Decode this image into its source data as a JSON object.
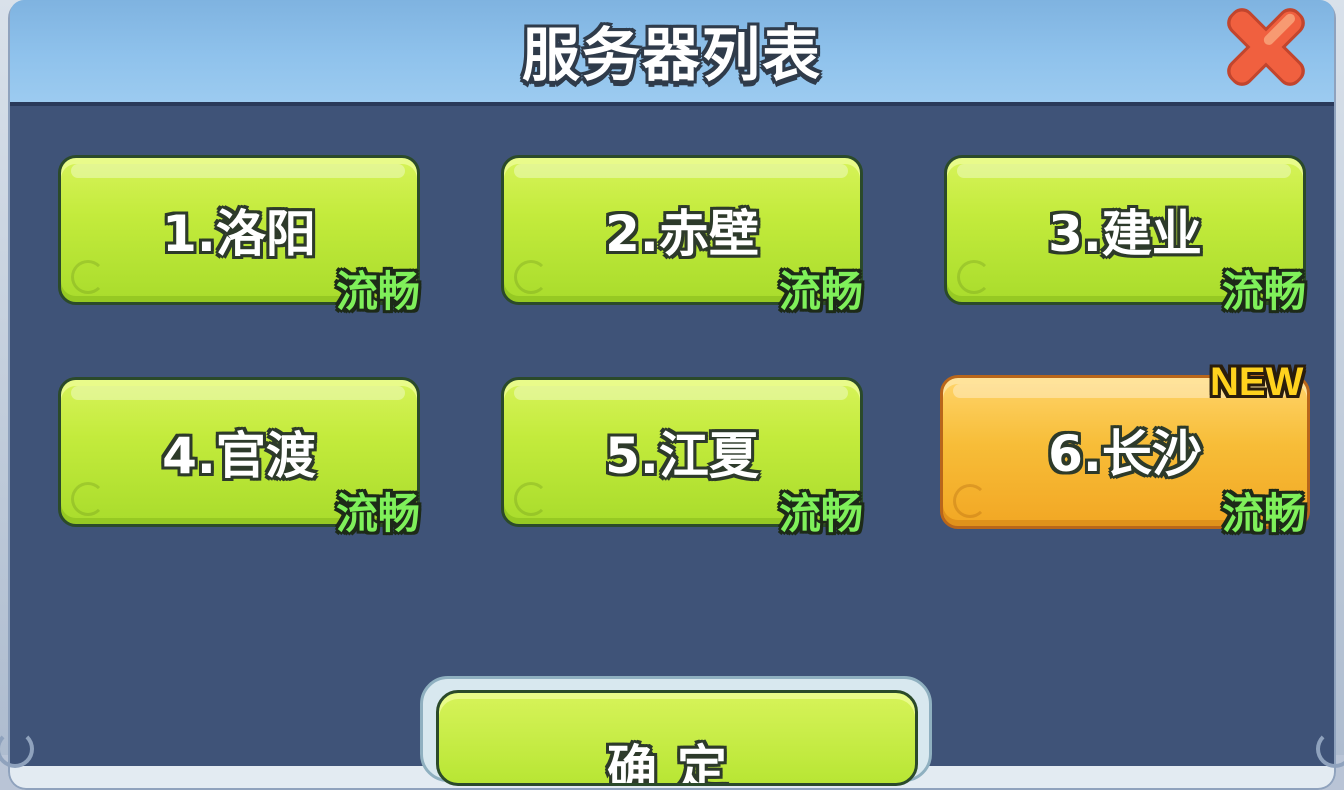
{
  "dialog": {
    "title": "服务器列表",
    "close_icon": "close-x-icon"
  },
  "servers": [
    {
      "name": "1.洛阳",
      "status": "流畅",
      "is_new": false
    },
    {
      "name": "2.赤壁",
      "status": "流畅",
      "is_new": false
    },
    {
      "name": "3.建业",
      "status": "流畅",
      "is_new": false
    },
    {
      "name": "4.官渡",
      "status": "流畅",
      "is_new": false
    },
    {
      "name": "5.江夏",
      "status": "流畅",
      "is_new": false
    },
    {
      "name": "6.长沙",
      "status": "流畅",
      "is_new": true
    }
  ],
  "badge": {
    "new_label": "NEW"
  },
  "confirm": {
    "label": "确定"
  },
  "colors": {
    "server_green": "#c3eb3c",
    "server_selected_orange": "#f7bd38",
    "status_green": "#7ff05a",
    "new_badge_yellow": "#ffd21e",
    "panel_body": "#3f5378",
    "header_blue": "#8fc2ec",
    "close_red": "#f0523a"
  }
}
